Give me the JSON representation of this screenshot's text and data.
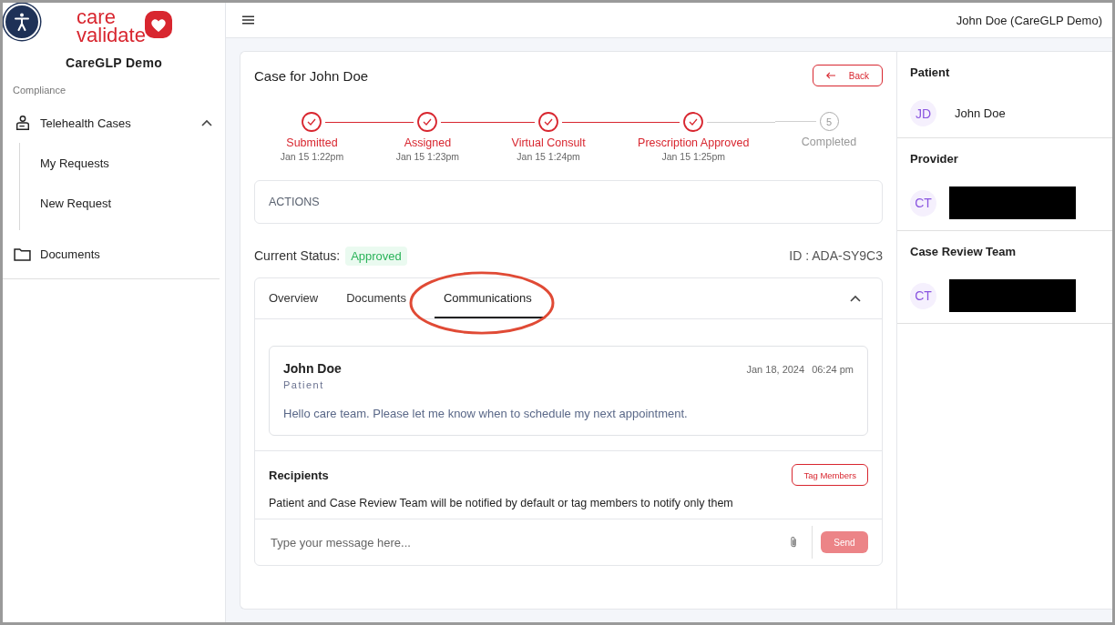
{
  "sidebar": {
    "logo": {
      "line1": "care",
      "line2": "validate"
    },
    "org": "CareGLP Demo",
    "section": "Compliance",
    "items": [
      {
        "label": "Telehealth Cases",
        "kind": "group",
        "expanded": true,
        "children": [
          {
            "label": "My Requests"
          },
          {
            "label": "New Request"
          }
        ]
      },
      {
        "label": "Documents",
        "kind": "folder"
      }
    ]
  },
  "header": {
    "user": "John Doe (CareGLP Demo)"
  },
  "case": {
    "title": "Case for John Doe",
    "back": "Back",
    "steps": [
      {
        "label": "Submitted",
        "time": "Jan 15 1:22pm",
        "completed": true
      },
      {
        "label": "Assigned",
        "time": "Jan 15 1:23pm",
        "completed": true
      },
      {
        "label": "Virtual Consult",
        "time": "Jan 15 1:24pm",
        "completed": true
      },
      {
        "label": "Prescription Approved",
        "time": "Jan 15 1:25pm",
        "completed": true
      },
      {
        "label": "Completed",
        "number": "5",
        "completed": false
      }
    ],
    "actions": "ACTIONS",
    "status_label": "Current Status:",
    "status": "Approved",
    "case_id": "ID : ADA-SY9C3",
    "tabs": [
      {
        "label": "Overview",
        "selected": false,
        "circled": false
      },
      {
        "label": "Documents",
        "selected": false,
        "circled": false
      },
      {
        "label": "Communications",
        "selected": true,
        "circled": true
      }
    ],
    "messages": [
      {
        "author": "John Doe",
        "role": "Patient",
        "date": "Jan 18, 2024",
        "time": "06:24 pm",
        "text": "Hello care team. Please let me know when to schedule my next appointment."
      }
    ],
    "recipients": {
      "title": "Recipients",
      "button": "Tag Members",
      "note": "Patient and Case Review Team will be notified by default or tag members to notify only them"
    },
    "composer": {
      "placeholder": "Type your message here...",
      "send": "Send"
    }
  },
  "panel": {
    "sections": [
      {
        "title": "Patient",
        "members": [
          {
            "initials": "JD",
            "name": "John Doe",
            "redacted": false
          }
        ]
      },
      {
        "title": "Provider",
        "members": [
          {
            "initials": "CT",
            "redacted": true
          }
        ]
      },
      {
        "title": "Case Review Team",
        "members": [
          {
            "initials": "CT",
            "redacted": true
          }
        ]
      }
    ]
  }
}
